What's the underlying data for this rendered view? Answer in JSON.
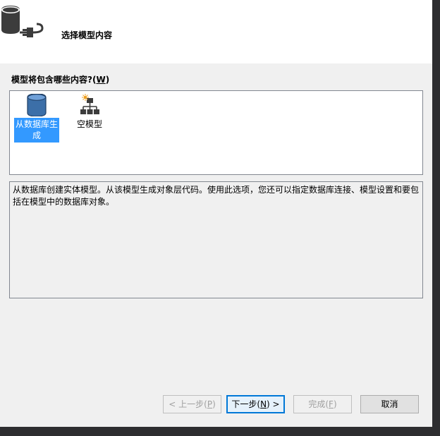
{
  "header": {
    "title": "选择模型内容",
    "icon": "database-connect-icon"
  },
  "prompt": {
    "label": "模型将包含哪些内容?(",
    "access_key": "W",
    "label_end": ")"
  },
  "choices": [
    {
      "label": "从数据库生成",
      "icon": "database-icon",
      "selected": true
    },
    {
      "label": "空模型",
      "icon": "empty-model-icon",
      "selected": false
    }
  ],
  "description": "从数据库创建实体模型。从该模型生成对象层代码。使用此选项，您还可以指定数据库连接、模型设置和要包括在模型中的数据库对象。",
  "buttons": {
    "back": {
      "prefix": "< 上一步(",
      "key": "P",
      "suffix": ")",
      "enabled": false
    },
    "next": {
      "prefix": "下一步(",
      "key": "N",
      "suffix": ") >",
      "enabled": true
    },
    "finish": {
      "prefix": "完成(",
      "key": "F",
      "suffix": ")",
      "enabled": false
    },
    "cancel": {
      "label": "取消",
      "enabled": true
    }
  },
  "colors": {
    "selection": "#3399ff",
    "dialog_bg": "#f0f0f0",
    "accent_border": "#0078d7"
  }
}
